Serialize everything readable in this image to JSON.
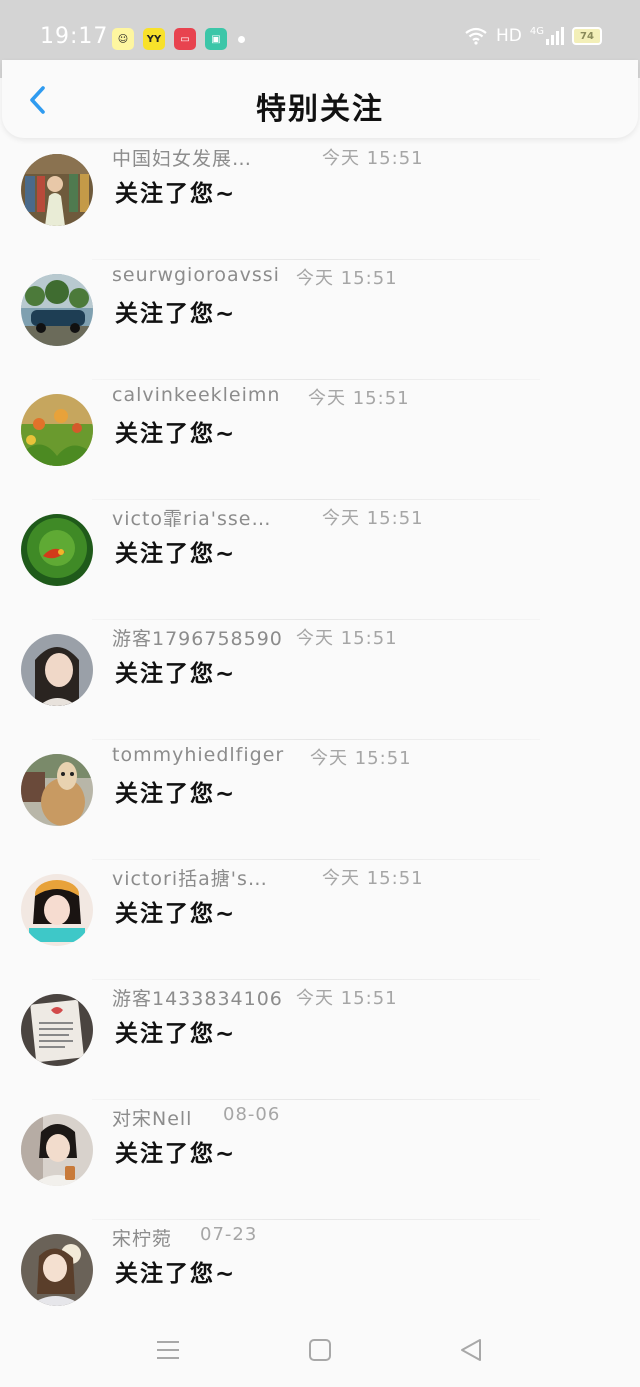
{
  "status_bar": {
    "time": "19:17",
    "network": "HD",
    "signal": "4G",
    "battery": "74",
    "app_icons": [
      {
        "name": "smiley-app-icon",
        "color": "#fef6a0",
        "glyph": "☺"
      },
      {
        "name": "yy-app-icon",
        "color": "#f8e12a",
        "glyph": "YY"
      },
      {
        "name": "video-app-icon",
        "color": "#e8434f",
        "glyph": "▭"
      },
      {
        "name": "tile-app-icon",
        "color": "#3cc6a8",
        "glyph": "▣"
      }
    ]
  },
  "header": {
    "title": "特别关注",
    "back_icon": "chevron-left-icon",
    "accent_color": "#2f9bf0"
  },
  "items": [
    {
      "name": "中国妇女发展…",
      "time": "今天 15:51",
      "message": "关注了您~"
    },
    {
      "name": "seurwgioroavssi",
      "time": "今天 15:51",
      "message": "关注了您~"
    },
    {
      "name": "calvinkeekleimn",
      "time": "今天 15:51",
      "message": "关注了您~"
    },
    {
      "name": "victo霏ria'sse…",
      "time": "今天 15:51",
      "message": "关注了您~"
    },
    {
      "name": "游客1796758590",
      "time": "今天 15:51",
      "message": "关注了您~"
    },
    {
      "name": "tommyhiedlfiger",
      "time": "今天 15:51",
      "message": "关注了您~"
    },
    {
      "name": "victori括a搪's…",
      "time": "今天 15:51",
      "message": "关注了您~"
    },
    {
      "name": "游客1433834106",
      "time": "今天 15:51",
      "message": "关注了您~"
    },
    {
      "name": "对宋Nell",
      "time": "08-06",
      "message": "关注了您~"
    },
    {
      "name": "宋柠菀",
      "time": "07-23",
      "message": "关注了您~"
    }
  ],
  "nav_bar": {
    "menu_icon": "menu-icon",
    "home_icon": "square-home-icon",
    "back_icon": "triangle-back-icon"
  }
}
